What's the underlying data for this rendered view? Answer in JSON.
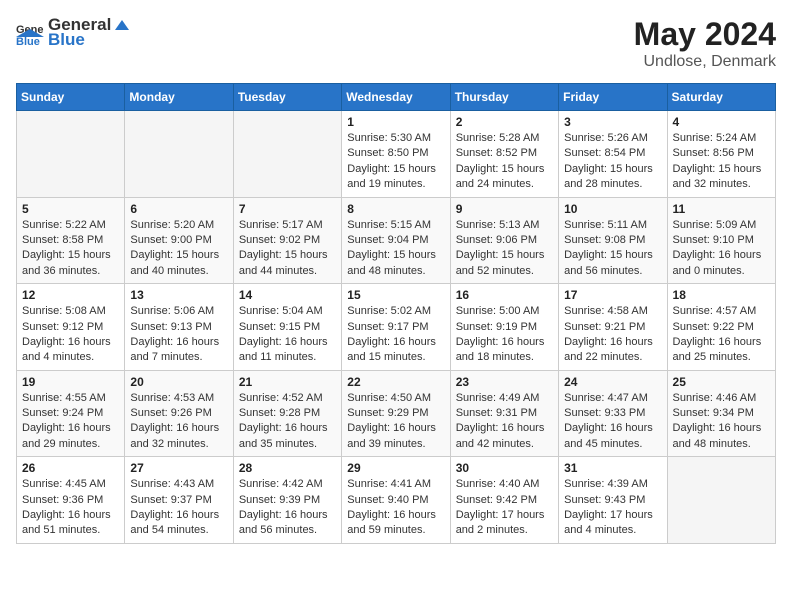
{
  "header": {
    "logo_general": "General",
    "logo_blue": "Blue",
    "month_year": "May 2024",
    "location": "Undlose, Denmark"
  },
  "days_of_week": [
    "Sunday",
    "Monday",
    "Tuesday",
    "Wednesday",
    "Thursday",
    "Friday",
    "Saturday"
  ],
  "weeks": [
    [
      {
        "day": "",
        "info": ""
      },
      {
        "day": "",
        "info": ""
      },
      {
        "day": "",
        "info": ""
      },
      {
        "day": "1",
        "info": "Sunrise: 5:30 AM\nSunset: 8:50 PM\nDaylight: 15 hours\nand 19 minutes."
      },
      {
        "day": "2",
        "info": "Sunrise: 5:28 AM\nSunset: 8:52 PM\nDaylight: 15 hours\nand 24 minutes."
      },
      {
        "day": "3",
        "info": "Sunrise: 5:26 AM\nSunset: 8:54 PM\nDaylight: 15 hours\nand 28 minutes."
      },
      {
        "day": "4",
        "info": "Sunrise: 5:24 AM\nSunset: 8:56 PM\nDaylight: 15 hours\nand 32 minutes."
      }
    ],
    [
      {
        "day": "5",
        "info": "Sunrise: 5:22 AM\nSunset: 8:58 PM\nDaylight: 15 hours\nand 36 minutes."
      },
      {
        "day": "6",
        "info": "Sunrise: 5:20 AM\nSunset: 9:00 PM\nDaylight: 15 hours\nand 40 minutes."
      },
      {
        "day": "7",
        "info": "Sunrise: 5:17 AM\nSunset: 9:02 PM\nDaylight: 15 hours\nand 44 minutes."
      },
      {
        "day": "8",
        "info": "Sunrise: 5:15 AM\nSunset: 9:04 PM\nDaylight: 15 hours\nand 48 minutes."
      },
      {
        "day": "9",
        "info": "Sunrise: 5:13 AM\nSunset: 9:06 PM\nDaylight: 15 hours\nand 52 minutes."
      },
      {
        "day": "10",
        "info": "Sunrise: 5:11 AM\nSunset: 9:08 PM\nDaylight: 15 hours\nand 56 minutes."
      },
      {
        "day": "11",
        "info": "Sunrise: 5:09 AM\nSunset: 9:10 PM\nDaylight: 16 hours\nand 0 minutes."
      }
    ],
    [
      {
        "day": "12",
        "info": "Sunrise: 5:08 AM\nSunset: 9:12 PM\nDaylight: 16 hours\nand 4 minutes."
      },
      {
        "day": "13",
        "info": "Sunrise: 5:06 AM\nSunset: 9:13 PM\nDaylight: 16 hours\nand 7 minutes."
      },
      {
        "day": "14",
        "info": "Sunrise: 5:04 AM\nSunset: 9:15 PM\nDaylight: 16 hours\nand 11 minutes."
      },
      {
        "day": "15",
        "info": "Sunrise: 5:02 AM\nSunset: 9:17 PM\nDaylight: 16 hours\nand 15 minutes."
      },
      {
        "day": "16",
        "info": "Sunrise: 5:00 AM\nSunset: 9:19 PM\nDaylight: 16 hours\nand 18 minutes."
      },
      {
        "day": "17",
        "info": "Sunrise: 4:58 AM\nSunset: 9:21 PM\nDaylight: 16 hours\nand 22 minutes."
      },
      {
        "day": "18",
        "info": "Sunrise: 4:57 AM\nSunset: 9:22 PM\nDaylight: 16 hours\nand 25 minutes."
      }
    ],
    [
      {
        "day": "19",
        "info": "Sunrise: 4:55 AM\nSunset: 9:24 PM\nDaylight: 16 hours\nand 29 minutes."
      },
      {
        "day": "20",
        "info": "Sunrise: 4:53 AM\nSunset: 9:26 PM\nDaylight: 16 hours\nand 32 minutes."
      },
      {
        "day": "21",
        "info": "Sunrise: 4:52 AM\nSunset: 9:28 PM\nDaylight: 16 hours\nand 35 minutes."
      },
      {
        "day": "22",
        "info": "Sunrise: 4:50 AM\nSunset: 9:29 PM\nDaylight: 16 hours\nand 39 minutes."
      },
      {
        "day": "23",
        "info": "Sunrise: 4:49 AM\nSunset: 9:31 PM\nDaylight: 16 hours\nand 42 minutes."
      },
      {
        "day": "24",
        "info": "Sunrise: 4:47 AM\nSunset: 9:33 PM\nDaylight: 16 hours\nand 45 minutes."
      },
      {
        "day": "25",
        "info": "Sunrise: 4:46 AM\nSunset: 9:34 PM\nDaylight: 16 hours\nand 48 minutes."
      }
    ],
    [
      {
        "day": "26",
        "info": "Sunrise: 4:45 AM\nSunset: 9:36 PM\nDaylight: 16 hours\nand 51 minutes."
      },
      {
        "day": "27",
        "info": "Sunrise: 4:43 AM\nSunset: 9:37 PM\nDaylight: 16 hours\nand 54 minutes."
      },
      {
        "day": "28",
        "info": "Sunrise: 4:42 AM\nSunset: 9:39 PM\nDaylight: 16 hours\nand 56 minutes."
      },
      {
        "day": "29",
        "info": "Sunrise: 4:41 AM\nSunset: 9:40 PM\nDaylight: 16 hours\nand 59 minutes."
      },
      {
        "day": "30",
        "info": "Sunrise: 4:40 AM\nSunset: 9:42 PM\nDaylight: 17 hours\nand 2 minutes."
      },
      {
        "day": "31",
        "info": "Sunrise: 4:39 AM\nSunset: 9:43 PM\nDaylight: 17 hours\nand 4 minutes."
      },
      {
        "day": "",
        "info": ""
      }
    ]
  ]
}
